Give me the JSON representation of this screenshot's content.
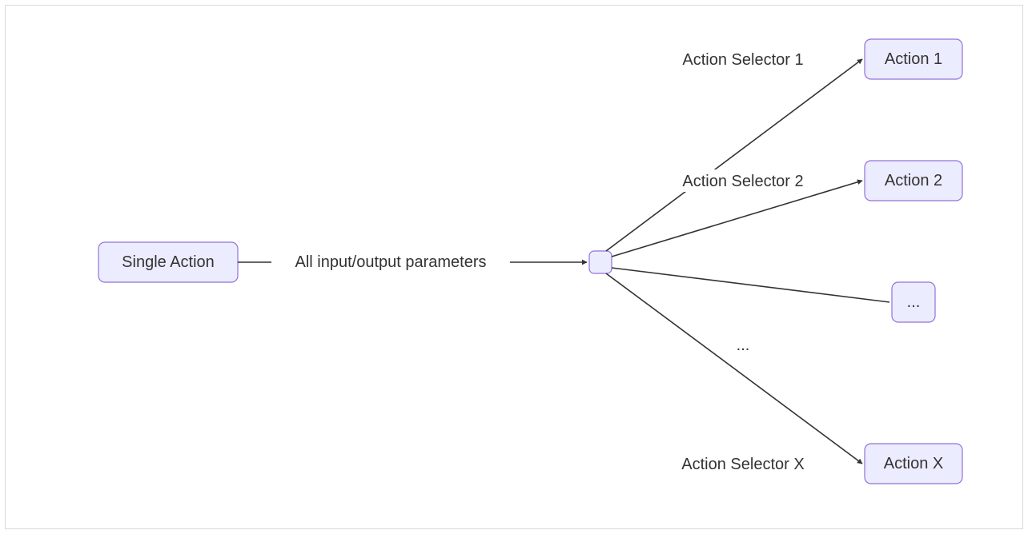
{
  "diagram": {
    "nodes": {
      "single_action": "Single Action",
      "action_1": "Action 1",
      "action_2": "Action 2",
      "ellipsis_box": "...",
      "action_x": "Action X"
    },
    "edges": {
      "input_output": "All input/output parameters",
      "selector_1": "Action Selector 1",
      "selector_2": "Action Selector 2",
      "selector_ellipsis": "...",
      "selector_x": "Action Selector X"
    }
  }
}
